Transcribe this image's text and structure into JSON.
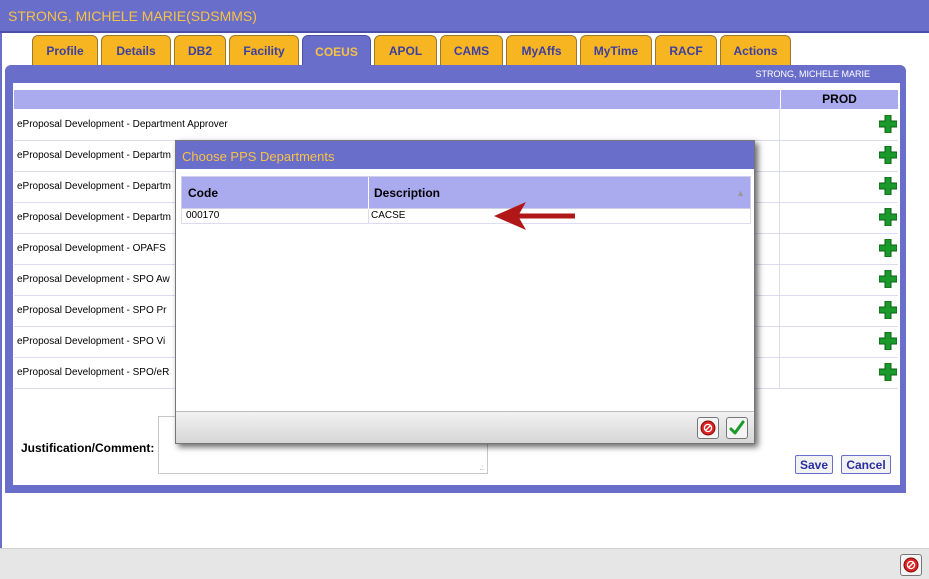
{
  "header": {
    "title": "STRONG, MICHELE MARIE(SDSMMS)"
  },
  "tabs": [
    {
      "label": "Profile",
      "active": false
    },
    {
      "label": "Details",
      "active": false
    },
    {
      "label": "DB2",
      "active": false
    },
    {
      "label": "Facility",
      "active": false
    },
    {
      "label": "COEUS",
      "active": true
    },
    {
      "label": "APOL",
      "active": false
    },
    {
      "label": "CAMS",
      "active": false
    },
    {
      "label": "MyAffs",
      "active": false
    },
    {
      "label": "MyTime",
      "active": false
    },
    {
      "label": "RACF",
      "active": false
    },
    {
      "label": "Actions",
      "active": false
    }
  ],
  "panel": {
    "user_name": "STRONG, MICHELE MARIE"
  },
  "table": {
    "prod_header": "PROD",
    "rows": [
      {
        "label": "eProposal Development - Department Approver"
      },
      {
        "label": "eProposal Development - Departm"
      },
      {
        "label": "eProposal Development - Departm"
      },
      {
        "label": "eProposal Development - Departm"
      },
      {
        "label": "eProposal Development - OPAFS"
      },
      {
        "label": "eProposal Development - SPO Aw"
      },
      {
        "label": "eProposal Development - SPO Pr"
      },
      {
        "label": "eProposal Development - SPO Vi"
      },
      {
        "label": "eProposal Development - SPO/eR"
      }
    ]
  },
  "comment": {
    "label": "Justification/Comment:",
    "value": ""
  },
  "buttons": {
    "save": "Save",
    "cancel": "Cancel"
  },
  "dialog": {
    "title": "Choose PPS Departments",
    "columns": {
      "code": "Code",
      "description": "Description"
    },
    "rows": [
      {
        "code": "000170",
        "description": "CACSE"
      }
    ]
  },
  "colors": {
    "accent": "#6a6ecb",
    "tab": "#f7b522",
    "title_text": "#f6c244",
    "add_icon": "#1a9a2a",
    "annotation_arrow": "#b01818"
  }
}
